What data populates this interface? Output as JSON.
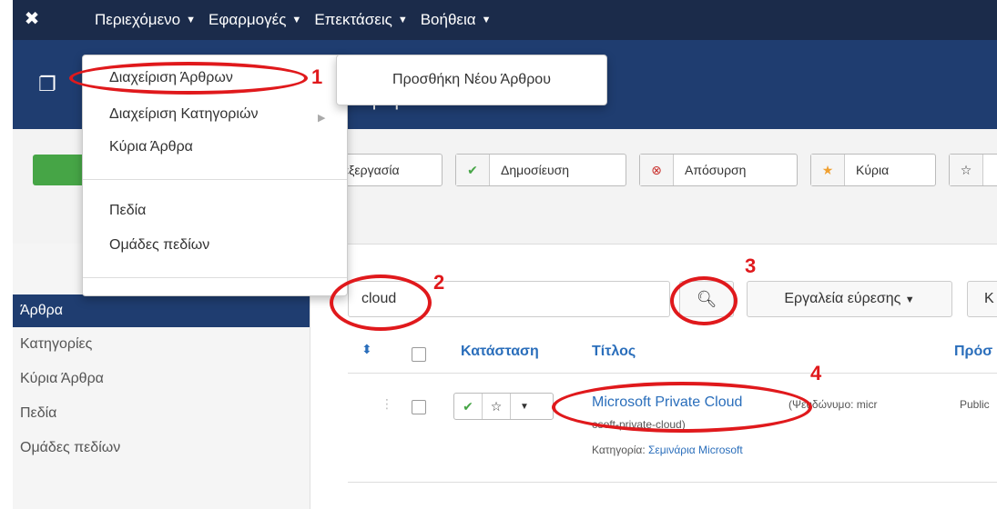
{
  "topnav": {
    "menu": [
      "Περιεχόμενο",
      "Εφαρμογές",
      "Επεκτάσεις",
      "Βοήθεια"
    ],
    "logo_icon": "joomla-logo-icon"
  },
  "header": {
    "title": "Άρθρα"
  },
  "dropdown": {
    "items": [
      "Διαχείριση Άρθρων",
      "Διαχείριση Κατηγοριών",
      "Κύρια Άρθρα",
      "Πεδία",
      "Ομάδες πεδίων"
    ],
    "submenu": "Προσθήκη Νέου Άρθρου"
  },
  "toolbar": {
    "edit": "επεξεργασία",
    "publish": "Δημοσίευση",
    "unpublish": "Απόσυρση",
    "featured": "Κύρια"
  },
  "sidebar": {
    "items": [
      "Άρθρα",
      "Κατηγορίες",
      "Κύρια Άρθρα",
      "Πεδία",
      "Ομάδες πεδίων"
    ]
  },
  "search": {
    "value": "cloud",
    "tools_label": "Εργαλεία εύρεσης",
    "cut_label": "Κ"
  },
  "table": {
    "headers": {
      "status": "Κατάσταση",
      "title": "Τίτλος",
      "access": "Πρόσ"
    },
    "row": {
      "title": "Microsoft Private Cloud",
      "alias_part1": "(Ψευδώνυμο: micr",
      "alias_part2": "osoft-private-cloud)",
      "category_label": "Κατηγορία:",
      "category": "Σεμινάρια Microsoft",
      "access": "Public"
    }
  },
  "annotations": [
    "1",
    "2",
    "3",
    "4"
  ],
  "colors": {
    "navbar": "#1b2b4a",
    "header": "#1f3d70",
    "accent_link": "#2a6ebb",
    "annotation_red": "#e0191c",
    "green": "#46a546"
  }
}
